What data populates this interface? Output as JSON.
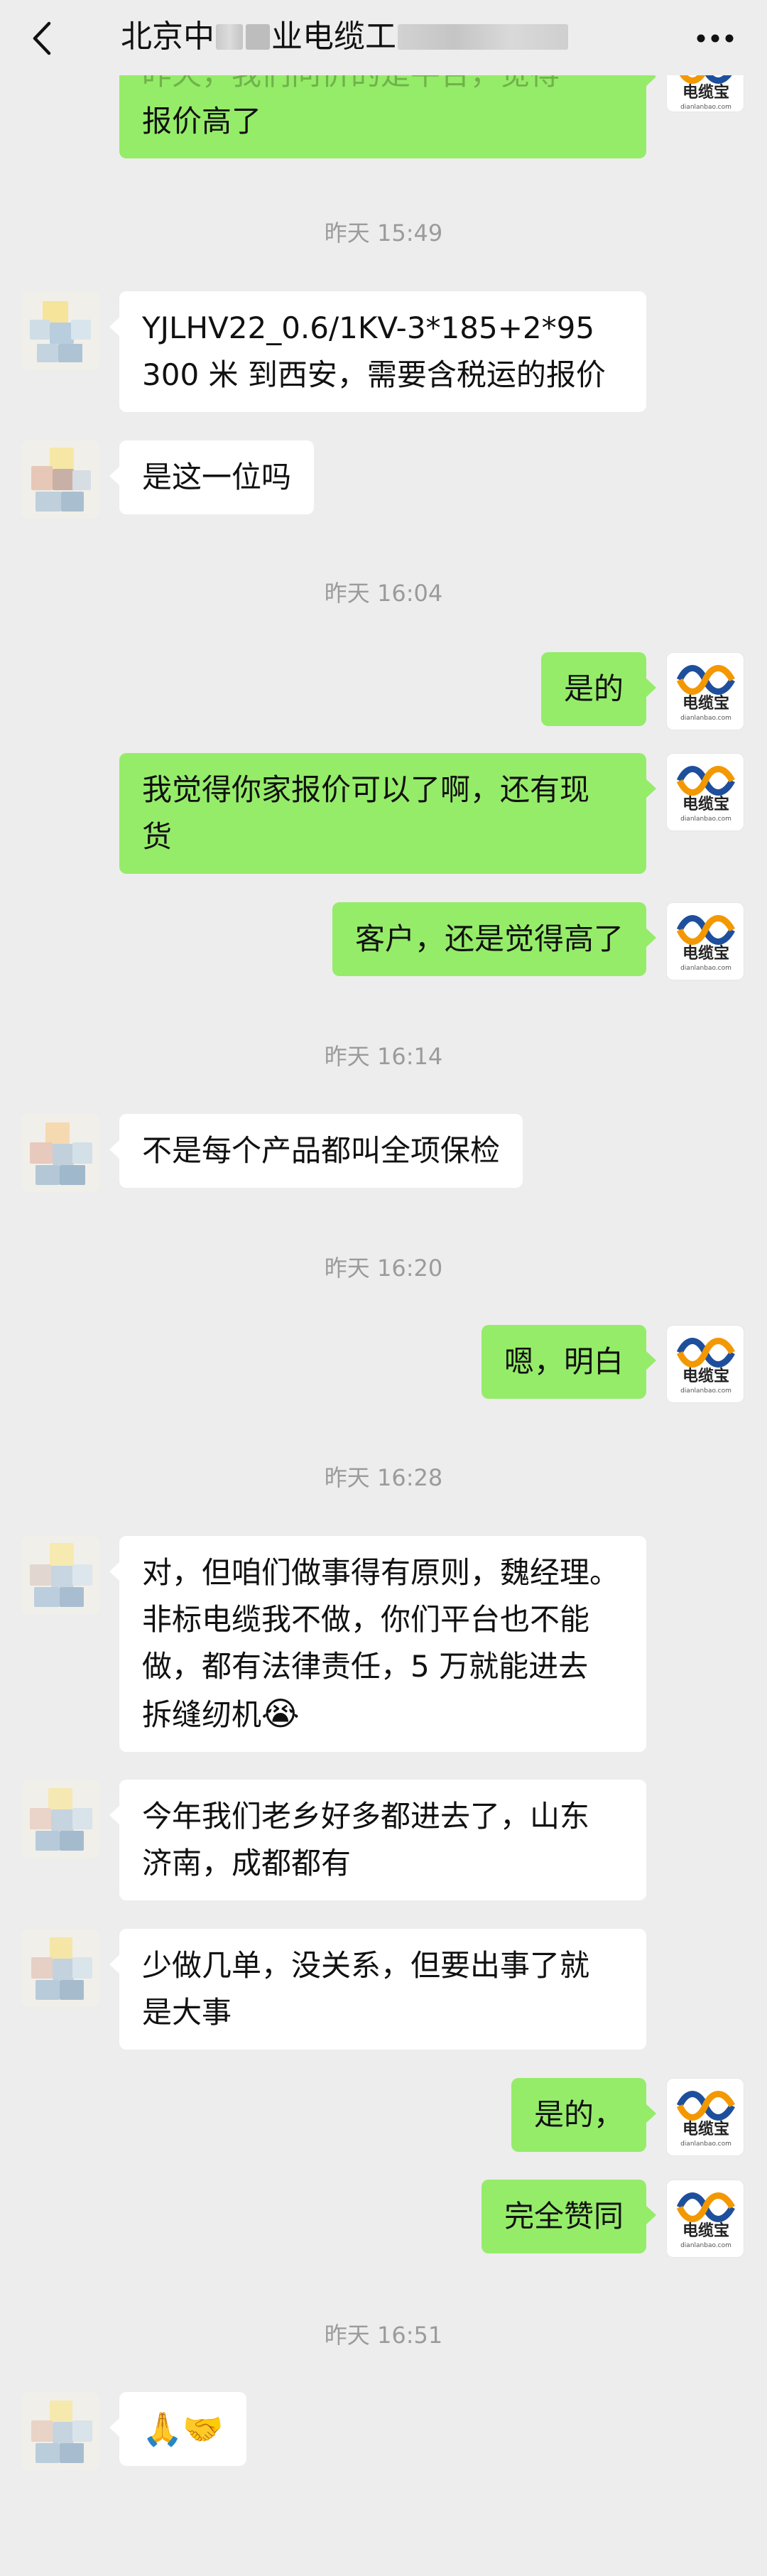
{
  "header": {
    "title_visible_start": "北京中",
    "title_visible_mid": "业电缆",
    "title_visible_end": "工"
  },
  "icons": {
    "back": "chevron-left-icon",
    "more": "more-dots-icon"
  },
  "messages": {
    "m0_line1": "昨天，我们问价的是平台，觉得",
    "m0_line2": "报价高了",
    "ts1": "昨天 15:49",
    "m1_line1": "YJLHV22_0.6/1KV-3*185+2*95",
    "m1_line2": "300 米 到西安，需要含税运的报价",
    "m2": "是这一位吗",
    "ts2": "昨天 16:04",
    "m3": "是的",
    "m4_line1": "我觉得你家报价可以了啊，还有现",
    "m4_line2": "货",
    "m5": "客户，还是觉得高了",
    "ts3": "昨天 16:14",
    "m6": "不是每个产品都叫全项保检",
    "ts4": "昨天 16:20",
    "m7": "嗯，明白",
    "ts5": "昨天 16:28",
    "m8_line1": "对，但咱们做事得有原则，魏经理。",
    "m8_line2": "非标电缆我不做，你们平台也不能",
    "m8_line3": "做，都有法律责任，5 万就能进去",
    "m8_line4": "拆缝纫机",
    "m8_emoji": "😭",
    "m9_line1": "今年我们老乡好多都进去了，山东",
    "m9_line2": "济南，成都都有",
    "m10_line1": "少做几单，没关系，但要出事了就",
    "m10_line2": "是大事",
    "m11": "是的，",
    "m12": "完全赞同",
    "ts6": "昨天 16:51",
    "m13": "🙏🤝"
  },
  "logo": {
    "brand_text": "电缆宝",
    "domain_text": "dianlanbao.com",
    "colors": {
      "blue": "#1e4f9c",
      "orange": "#f39800",
      "text": "#222222"
    }
  },
  "colors": {
    "background": "#ededed",
    "incoming_bubble": "#ffffff",
    "outgoing_bubble": "#95ec69",
    "timestamp": "#9b9b9b"
  }
}
